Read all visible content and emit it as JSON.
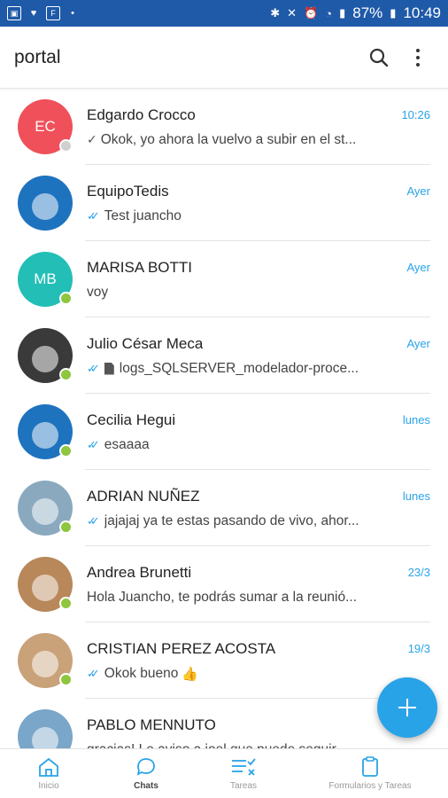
{
  "status_bar": {
    "battery": "87%",
    "time": "10:49"
  },
  "header": {
    "title": "portal"
  },
  "chats": [
    {
      "name": "Edgardo Crocco",
      "time": "10:26",
      "preview": "Okok, yo ahora la vuelvo a subir en el st...",
      "initials": "EC",
      "avatar_color": "#f0505a",
      "status": "offline",
      "receipt": "single"
    },
    {
      "name": "EquipoTedis",
      "time": "Ayer",
      "preview": "Test juancho",
      "initials": "",
      "avatar_color": "#1e73be",
      "status": "none",
      "receipt": "double"
    },
    {
      "name": "MARISA BOTTI",
      "time": "Ayer",
      "preview": "voy",
      "initials": "MB",
      "avatar_color": "#23bfb6",
      "status": "online",
      "receipt": "none"
    },
    {
      "name": "Julio César Meca",
      "time": "Ayer",
      "preview": "logs_SQLSERVER_modelador-proce...",
      "initials": "",
      "avatar_color": "#3a3a3a",
      "status": "online",
      "receipt": "double",
      "attachment": "file-icon"
    },
    {
      "name": "Cecilia Hegui",
      "time": "lunes",
      "preview": "esaaaa",
      "initials": "",
      "avatar_color": "#1e73be",
      "status": "online",
      "receipt": "double"
    },
    {
      "name": "ADRIAN NUÑEZ",
      "time": "lunes",
      "preview": "jajajaj ya te estas pasando de vivo, ahor...",
      "initials": "",
      "avatar_color": "#8aa9bf",
      "status": "online",
      "receipt": "double"
    },
    {
      "name": "Andrea Brunetti",
      "time": "23/3",
      "preview": "Hola Juancho, te podrás sumar a la reunió...",
      "initials": "",
      "avatar_color": "#b8875a",
      "status": "online",
      "receipt": "none"
    },
    {
      "name": "CRISTIAN PEREZ ACOSTA",
      "time": "19/3",
      "preview": "Okok bueno",
      "initials": "",
      "avatar_color": "#c9a27a",
      "status": "online",
      "receipt": "double",
      "emoji": "👍"
    },
    {
      "name": "PABLO MENNUTO",
      "time": "",
      "preview": "gracias! Le aviso a joel que puede seguir...",
      "initials": "",
      "avatar_color": "#7aa6c9",
      "status": "none",
      "receipt": "none"
    }
  ],
  "nav": [
    {
      "label": "Inicio",
      "icon": "home-icon"
    },
    {
      "label": "Chats",
      "icon": "chat-icon"
    },
    {
      "label": "Tareas",
      "icon": "tasks-icon"
    },
    {
      "label": "Formularios y Tareas",
      "icon": "clipboard-icon"
    }
  ],
  "colors": {
    "status_bar": "#1f5aa8",
    "accent": "#29a3e8",
    "online": "#8ec63f"
  }
}
